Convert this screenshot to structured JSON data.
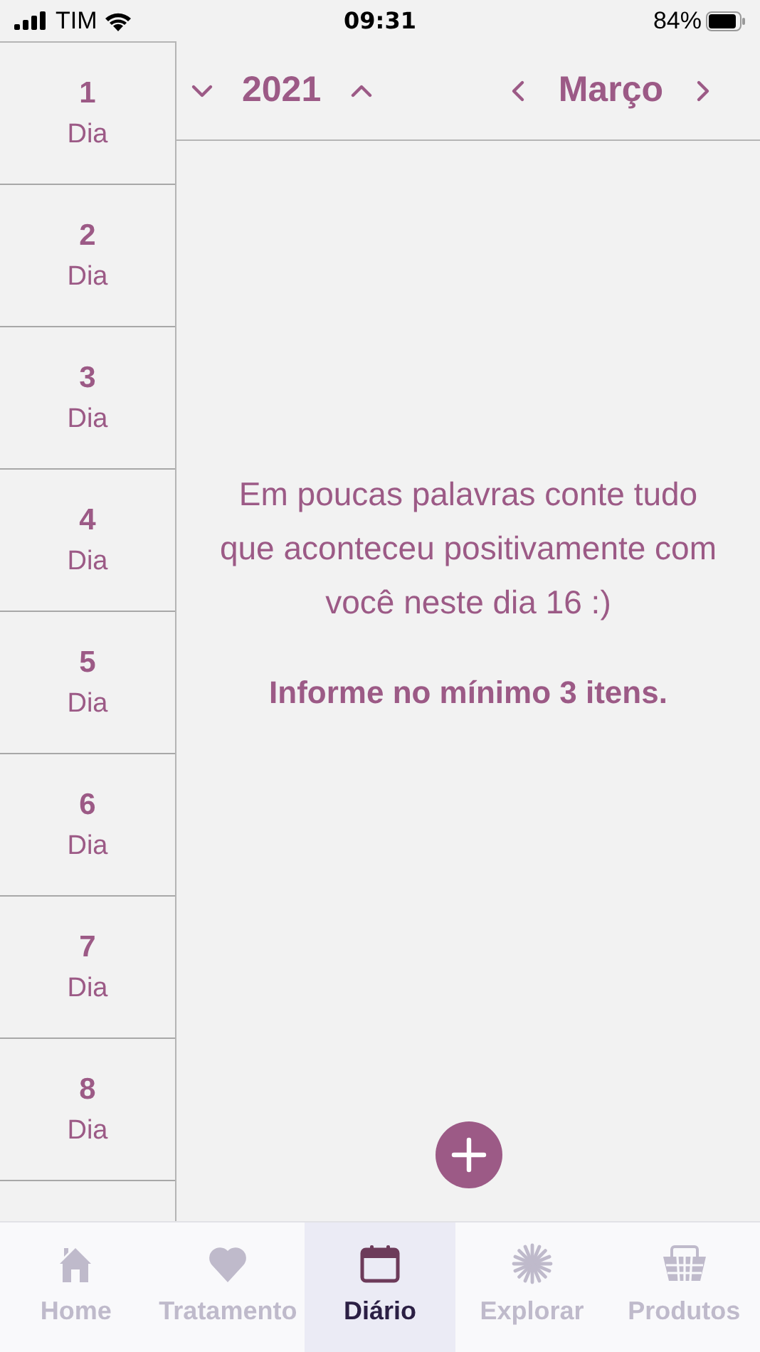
{
  "status_bar": {
    "carrier": "TIM",
    "time": "09:31",
    "battery": "84%"
  },
  "days": [
    {
      "number": "1",
      "label": "Dia"
    },
    {
      "number": "2",
      "label": "Dia"
    },
    {
      "number": "3",
      "label": "Dia"
    },
    {
      "number": "4",
      "label": "Dia"
    },
    {
      "number": "5",
      "label": "Dia"
    },
    {
      "number": "6",
      "label": "Dia"
    },
    {
      "number": "7",
      "label": "Dia"
    },
    {
      "number": "8",
      "label": "Dia"
    }
  ],
  "header": {
    "year": "2021",
    "month": "Março"
  },
  "prompt": {
    "message": "Em poucas palavras conte tudo que aconteceu positivamente com você neste dia 16 :)",
    "instruction": "Informe no mínimo 3 itens."
  },
  "tabs": [
    {
      "label": "Home",
      "kind": "home",
      "selected": false
    },
    {
      "label": "Tratamento",
      "kind": "heart",
      "selected": false
    },
    {
      "label": "Diário",
      "kind": "calendar",
      "selected": true
    },
    {
      "label": "Explorar",
      "kind": "burst",
      "selected": false
    },
    {
      "label": "Produtos",
      "kind": "basket",
      "selected": false
    }
  ]
}
